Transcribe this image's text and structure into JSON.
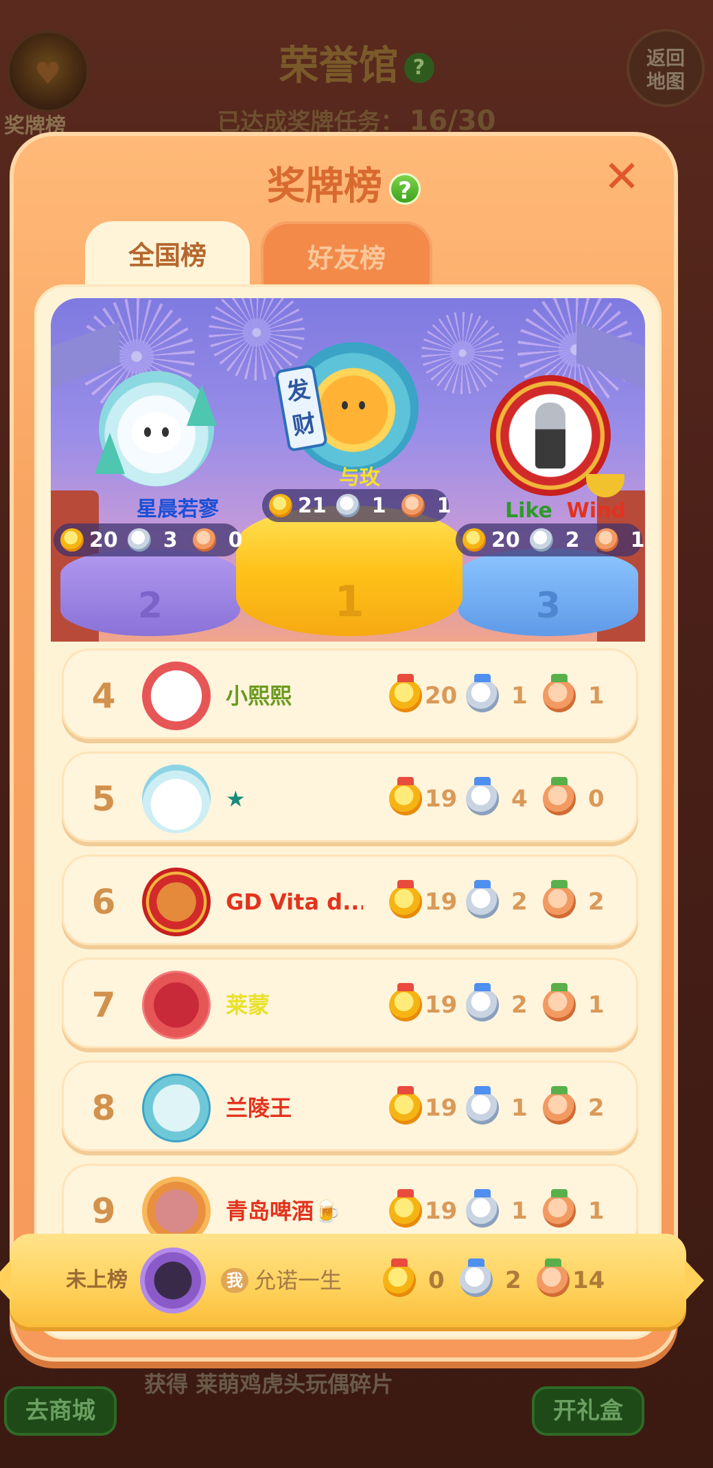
{
  "background": {
    "title": "荣誉馆",
    "medal_board_label": "奖牌榜",
    "back_button": "返回\n地图",
    "progress_label": "已达成奖牌任务：",
    "progress_value": "16/30",
    "footer_text": "获得 莱萌鸡虎头玩偶碎片",
    "shop_button": "去商城",
    "gift_button": "开礼盒"
  },
  "modal": {
    "title": "奖牌榜",
    "help_icon": "?",
    "close_icon": "✕",
    "tabs": [
      {
        "label": "全国榜",
        "active": true
      },
      {
        "label": "好友榜",
        "active": false
      }
    ]
  },
  "podium": {
    "first": {
      "rank": "1",
      "name": "与玫",
      "gold": "21",
      "silver": "1",
      "bronze": "1"
    },
    "second": {
      "rank": "2",
      "name": "星晨若寥",
      "gold": "20",
      "silver": "3",
      "bronze": "0"
    },
    "third": {
      "rank": "3",
      "name_part1": "Like",
      "name_part2": "Wind",
      "gold": "20",
      "silver": "2",
      "bronze": "1"
    }
  },
  "rows": [
    {
      "rank": "4",
      "name": "小熙熙",
      "name_color": "#6a9a1e",
      "gold": "20",
      "silver": "1",
      "bronze": "1"
    },
    {
      "rank": "5",
      "name": "★",
      "name_color": "#1a8a7a",
      "gold": "19",
      "silver": "4",
      "bronze": "0"
    },
    {
      "rank": "6",
      "name": "GD Vita d...",
      "name_color": "#e2331e",
      "gold": "19",
      "silver": "2",
      "bronze": "2"
    },
    {
      "rank": "7",
      "name": "莱蒙",
      "name_color": "#e8e22a",
      "gold": "19",
      "silver": "2",
      "bronze": "1"
    },
    {
      "rank": "8",
      "name": "兰陵王",
      "name_color": "#e2331e",
      "gold": "19",
      "silver": "1",
      "bronze": "2"
    },
    {
      "rank": "9",
      "name": "青岛啤酒🍺",
      "name_color": "#e2331e",
      "gold": "19",
      "silver": "1",
      "bronze": "1"
    }
  ],
  "my_rank": {
    "status": "未上榜",
    "me_badge": "我",
    "name": "允诺一生",
    "gold": "0",
    "silver": "2",
    "bronze": "14"
  },
  "colors": {
    "modal_bg": "#f9a562",
    "title": "#d86a30",
    "rank_number": "#d2914c",
    "gold_medal": "#f6b414",
    "silver_medal": "#c9d4e2",
    "bronze_medal": "#f29a62"
  }
}
